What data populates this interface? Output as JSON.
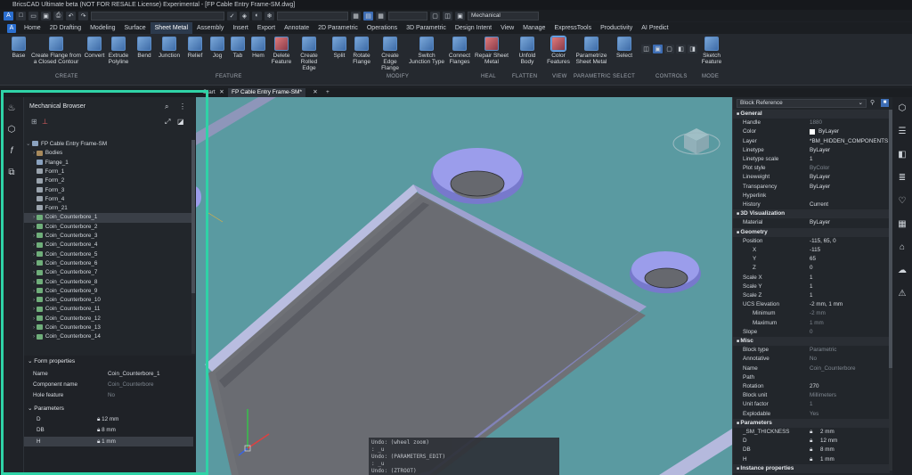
{
  "app": {
    "title": "BricsCAD Ultimate beta (NOT FOR RESALE License) Experimental - [FP Cable Entry Frame-SM.dwg]"
  },
  "qat": {
    "workspace": "Mechanical"
  },
  "menu": {
    "items": [
      "Home",
      "2D Drafting",
      "Modeling",
      "Surface",
      "Sheet Metal",
      "Assembly",
      "Insert",
      "Export",
      "Annotate",
      "2D Parametric",
      "Operations",
      "3D Parametric",
      "Design Intent",
      "View",
      "Manage",
      "ExpressTools",
      "Productivity",
      "AI Predict"
    ],
    "active": "Sheet Metal"
  },
  "ribbon": {
    "buttons": [
      {
        "label": "Base"
      },
      {
        "label": "Create Flange from a Closed Contour"
      },
      {
        "label": "Convert"
      },
      {
        "label": "Extrude Polyline"
      },
      {
        "label": "Bend"
      },
      {
        "label": "Junction"
      },
      {
        "label": "Relief"
      },
      {
        "label": "Jog"
      },
      {
        "label": "Tab"
      },
      {
        "label": "Hem"
      },
      {
        "label": "Delete Feature"
      },
      {
        "label": "Create Rolled Edge"
      },
      {
        "label": "Split"
      },
      {
        "label": "Rotate Flange"
      },
      {
        "label": "Create Edge Flange"
      },
      {
        "label": "Switch Junction Type"
      },
      {
        "label": "Connect Flanges"
      },
      {
        "label": "Repair Sheet Metal"
      },
      {
        "label": "Unfold Body"
      },
      {
        "label": "Color Features"
      },
      {
        "label": "Parametrize Sheet Metal"
      },
      {
        "label": "Select"
      },
      {
        "label": "Sketch Feature"
      }
    ],
    "groups": [
      "CREATE",
      "FEATURE",
      "MODIFY",
      "HEAL",
      "FLATTEN",
      "VIEW",
      "PARAMETRIC",
      "SELECT",
      "CONTROLS",
      "MODE"
    ]
  },
  "doc_tabs": {
    "start": "Start",
    "active": "FP Cable Entry Frame-SM*",
    "add": "+"
  },
  "browser": {
    "title": "Mechanical Browser",
    "root": "FP Cable Entry Frame-SM",
    "items": [
      "Bodies",
      "Flange_1",
      "Form_1",
      "Form_2",
      "Form_3",
      "Form_4",
      "Form_21",
      "Coin_Counterbore_1",
      "Coin_Counterbore_2",
      "Coin_Counterbore_3",
      "Coin_Counterbore_4",
      "Coin_Counterbore_5",
      "Coin_Counterbore_6",
      "Coin_Counterbore_7",
      "Coin_Counterbore_8",
      "Coin_Counterbore_9",
      "Coin_Counterbore_10",
      "Coin_Counterbore_11",
      "Coin_Counterbore_12",
      "Coin_Counterbore_13",
      "Coin_Counterbore_14"
    ],
    "selected": "Coin_Counterbore_1",
    "form_properties": {
      "header": "Form properties",
      "rows": [
        {
          "k": "Name",
          "v": "Coin_Counterbore_1"
        },
        {
          "k": "Component name",
          "v": "Coin_Counterbore"
        },
        {
          "k": "Hole feature",
          "v": "No"
        }
      ],
      "params_header": "Parameters",
      "params": [
        {
          "k": "D",
          "v": "12 mm"
        },
        {
          "k": "DB",
          "v": "8 mm"
        },
        {
          "k": "H",
          "v": "1 mm"
        }
      ]
    }
  },
  "command_line": {
    "lines": [
      "Undo: (wheel zoom)",
      ": _u",
      "Undo: (PARAMETERS_EDIT)",
      ": _u",
      "Undo: (ZTROOT)"
    ]
  },
  "properties": {
    "selector": "Block Reference",
    "sections": [
      {
        "title": "General",
        "rows": [
          {
            "k": "Handle",
            "v": "1880",
            "dim": true
          },
          {
            "k": "Color",
            "v": "ByLayer"
          },
          {
            "k": "Layer",
            "v": "*BM_HIDDEN_COMPONENTS"
          },
          {
            "k": "Linetype",
            "v": "ByLayer"
          },
          {
            "k": "Linetype scale",
            "v": "1"
          },
          {
            "k": "Plot style",
            "v": "ByColor",
            "dim": true
          },
          {
            "k": "Lineweight",
            "v": "ByLayer"
          },
          {
            "k": "Transparency",
            "v": "ByLayer"
          },
          {
            "k": "Hyperlink",
            "v": ""
          },
          {
            "k": "History",
            "v": "Current"
          }
        ]
      },
      {
        "title": "3D Visualization",
        "rows": [
          {
            "k": "Material",
            "v": "ByLayer"
          }
        ]
      },
      {
        "title": "Geometry",
        "rows": [
          {
            "k": "Position",
            "v": "-115, 65, 0"
          },
          {
            "k": "X",
            "v": "-115",
            "indent": true
          },
          {
            "k": "Y",
            "v": "65",
            "indent": true
          },
          {
            "k": "Z",
            "v": "0",
            "indent": true
          },
          {
            "k": "Scale X",
            "v": "1"
          },
          {
            "k": "Scale Y",
            "v": "1"
          },
          {
            "k": "Scale Z",
            "v": "1"
          },
          {
            "k": "UCS Elevation",
            "v": "-2 mm, 1 mm"
          },
          {
            "k": "Minimum",
            "v": "-2 mm",
            "indent": true,
            "dim": true
          },
          {
            "k": "Maximum",
            "v": "1 mm",
            "indent": true,
            "dim": true
          },
          {
            "k": "Slope",
            "v": "0",
            "dim": true
          }
        ]
      },
      {
        "title": "Misc",
        "rows": [
          {
            "k": "Block type",
            "v": "Parametric",
            "dim": true
          },
          {
            "k": "Annotative",
            "v": "No",
            "dim": true
          },
          {
            "k": "Name",
            "v": "Coin_Counterbore",
            "dim": true
          },
          {
            "k": "Path",
            "v": ""
          },
          {
            "k": "Rotation",
            "v": "270"
          },
          {
            "k": "Block unit",
            "v": "Millimeters",
            "dim": true
          },
          {
            "k": "Unit factor",
            "v": "1",
            "dim": true
          },
          {
            "k": "Explodable",
            "v": "Yes",
            "dim": true
          }
        ]
      },
      {
        "title": "Parameters",
        "rows": [
          {
            "k": "_SM_THICKNESS",
            "v": "2 mm"
          },
          {
            "k": "D",
            "v": "12 mm"
          },
          {
            "k": "DB",
            "v": "8 mm"
          },
          {
            "k": "H",
            "v": "1 mm"
          }
        ]
      },
      {
        "title": "Instance properties",
        "rows": []
      }
    ]
  },
  "colors": {
    "viewport_bg": "#5a9aa1",
    "highlight": "#2fd3a7",
    "counterbore": "#8c8ee8",
    "plate": "#6f7176"
  }
}
